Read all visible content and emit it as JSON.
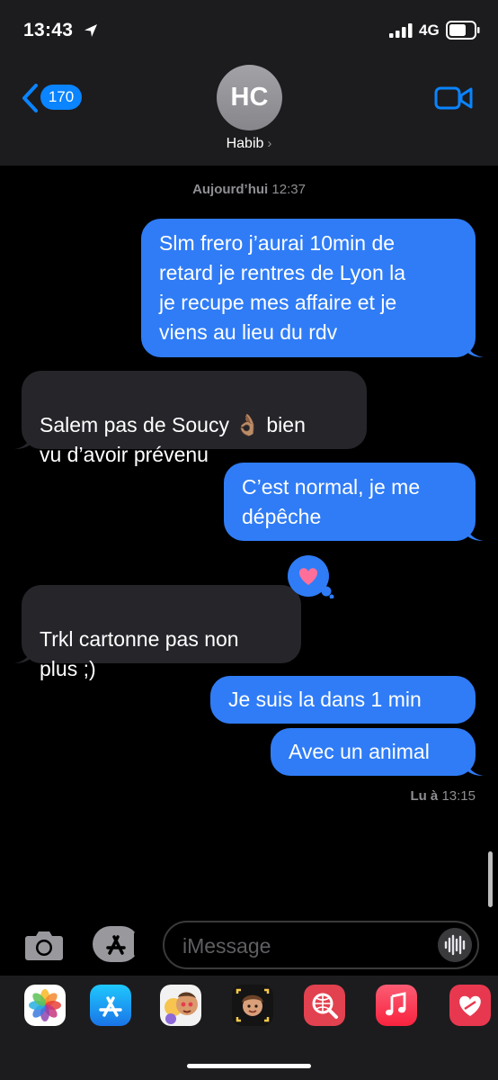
{
  "status_bar": {
    "time": "13:43",
    "network": "4G"
  },
  "header": {
    "back_count": "170",
    "avatar_initials": "HC",
    "contact_name": "Habib",
    "chevron": "›"
  },
  "thread": {
    "timestamp_day": "Aujourd’hui",
    "timestamp_time": "12:37",
    "messages": [
      {
        "direction": "sent",
        "text": "Slm frero j’aurai 10min de\nretard je rentres de Lyon la\nje recupe mes affaire et je\nviens au lieu du rdv"
      },
      {
        "direction": "received",
        "text": "Salem pas de Soucy 👌🏽 bien\nvu d’avoir prévenu"
      },
      {
        "direction": "sent",
        "text": "C’est normal, je me\ndépêche"
      },
      {
        "direction": "received",
        "text": "Trkl cartonne pas non\nplus ;)",
        "reaction": "heart-icon"
      },
      {
        "direction": "sent",
        "text": "Je suis la dans 1 min"
      },
      {
        "direction": "sent",
        "text": "Avec un animal"
      }
    ],
    "read_receipt_label": "Lu à",
    "read_receipt_time": "13:15"
  },
  "composer": {
    "placeholder": "iMessage"
  },
  "app_drawer": [
    {
      "icon": "photos-icon"
    },
    {
      "icon": "app-store-icon"
    },
    {
      "icon": "memoji-stickers-icon"
    },
    {
      "icon": "memoji-icon"
    },
    {
      "icon": "web-search-icon"
    },
    {
      "icon": "music-icon"
    },
    {
      "icon": "digital-touch-icon"
    }
  ],
  "colors": {
    "sent_bubble": "#2f7cf6",
    "received_bubble": "#26252a",
    "accent": "#0a84ff",
    "header_bg": "#1c1c1e",
    "background": "#000000"
  }
}
